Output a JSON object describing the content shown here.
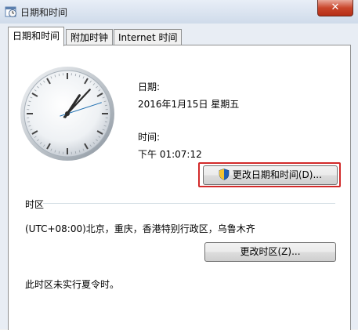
{
  "window": {
    "title": "日期和时间",
    "close_label": "✕"
  },
  "tabs": [
    {
      "label": "日期和时间",
      "active": true
    },
    {
      "label": "附加时钟",
      "active": false
    },
    {
      "label": "Internet 时间",
      "active": false
    }
  ],
  "datetime": {
    "date_label": "日期:",
    "date_value": "2016年1月15日 星期五",
    "time_label": "时间:",
    "time_value": "下午 01:07:12",
    "change_button": "更改日期和时间(D)..."
  },
  "timezone": {
    "section_label": "时区",
    "value": "(UTC+08:00)北京，重庆，香港特别行政区，乌鲁木齐",
    "change_button": "更改时区(Z)...",
    "dst_note": "此时区未实行夏令时。"
  },
  "clock": {
    "hour": 1,
    "minute": 7,
    "second": 12
  },
  "icons": {
    "title": "clock-calendar-icon",
    "shield": "uac-shield-icon"
  },
  "colors": {
    "highlight_border": "#d22a2a",
    "title_text": "#1e1e1e"
  }
}
